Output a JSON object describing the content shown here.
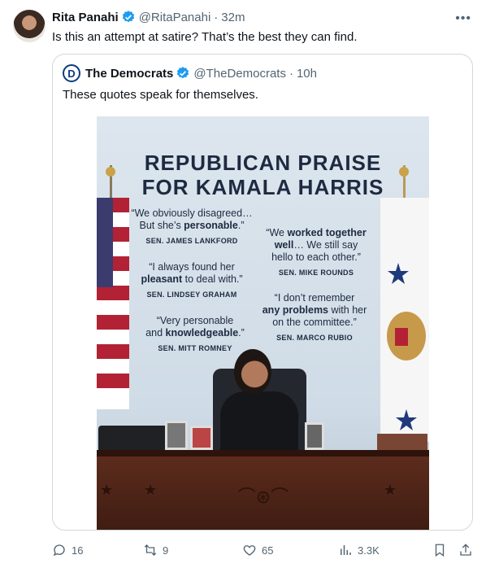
{
  "tweet": {
    "author_name": "Rita Panahi",
    "handle": "@RitaPanahi",
    "separator": "·",
    "time": "32m",
    "more_label": "•••",
    "text": "Is this an attempt at satire? That’s the best they can find."
  },
  "quoted": {
    "logo_letter": "D",
    "author_name": "The Democrats",
    "handle": "@TheDemocrats",
    "separator": "·",
    "time": "10h",
    "text": "These quotes speak for themselves.",
    "image": {
      "headline_line1": "REPUBLICAN PRAISE",
      "headline_line2": "FOR KAMALA HARRIS",
      "quotes": [
        {
          "pre": "“We obviously disagreed…",
          "line2_pre": "But she’s ",
          "bold": "personable",
          "post": ".”",
          "speaker": "SEN. JAMES LANKFORD"
        },
        {
          "pre": "“We ",
          "bold": "worked together",
          "line2_bold": "well",
          "post": "… We still say",
          "line3": "hello to each other.”",
          "speaker": "SEN. MIKE ROUNDS"
        },
        {
          "pre": "“I always found her",
          "bold": "pleasant",
          "post": " to deal with.”",
          "speaker": "SEN. LINDSEY GRAHAM"
        },
        {
          "pre": "“I don’t remember",
          "bold": "any problems",
          "post": " with her",
          "line3": "on the committee.”",
          "speaker": "SEN. MARCO RUBIO"
        },
        {
          "pre": "“Very personable",
          "line2_pre": "and ",
          "bold": "knowledgeable",
          "post": ".”",
          "speaker": "SEN. MITT ROMNEY"
        }
      ]
    }
  },
  "actions": {
    "replies": "16",
    "retweets": "9",
    "likes": "65",
    "views": "3.3K"
  },
  "colors": {
    "verified": "#1d9bf0",
    "muted": "#536471",
    "border": "#cfd9de"
  }
}
